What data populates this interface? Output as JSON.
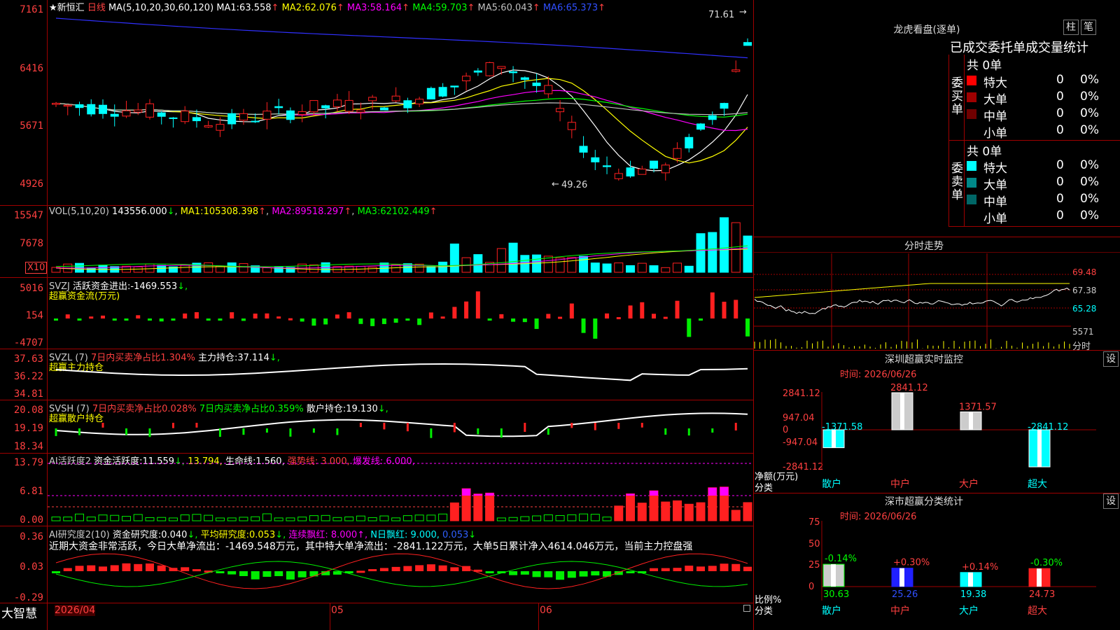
{
  "app": {
    "brand": "大智慧",
    "stock_name": "新恒汇",
    "period": "日线"
  },
  "colors": {
    "up": "#ff2020",
    "down": "#00ffff",
    "ma1": "#ffffff",
    "ma2": "#ffff00",
    "ma3": "#ff00ff",
    "ma4": "#00ff00",
    "ma5": "#c0c0c0",
    "ma6": "#3030ff",
    "grid": "#a00000",
    "label_red": "#ff4040"
  },
  "main_chart": {
    "legend_prefix": "MA(5,10,20,30,60,120)",
    "ma": [
      {
        "name": "MA1:",
        "value": "63.558",
        "arrow": "↑"
      },
      {
        "name": "MA2:",
        "value": "62.076",
        "arrow": "↑"
      },
      {
        "name": "MA3:",
        "value": "58.164",
        "arrow": "↑"
      },
      {
        "name": "MA4:",
        "value": "59.703",
        "arrow": "↑"
      },
      {
        "name": "MA5:",
        "value": "60.043",
        "arrow": "↑"
      },
      {
        "name": "MA6:",
        "value": "65.373",
        "arrow": "↑"
      }
    ],
    "y_ticks": [
      "7161",
      "6416",
      "5671",
      "4926"
    ],
    "high_label": "71.61",
    "low_label": "49.26"
  },
  "vol": {
    "header": "VOL(5,10,20)",
    "value": "143556.000",
    "arrow": "↓",
    "ma": [
      {
        "name": "MA1:",
        "value": "105308.398",
        "arrow": "↑"
      },
      {
        "name": "MA2:",
        "value": "89518.297",
        "arrow": "↑"
      },
      {
        "name": "MA3:",
        "value": "62102.449",
        "arrow": "↑"
      }
    ],
    "y_ticks": [
      "15547",
      "7678"
    ],
    "unit": "X10"
  },
  "svzj": {
    "header": "SVZJ",
    "label": "活跃资金进出:",
    "value": "-1469.553",
    "arrow": "↓,",
    "sub": "超赢资金流(万元)",
    "y_ticks": [
      "5016",
      "154",
      "-4707"
    ]
  },
  "svzl": {
    "header": "SVZL (7)",
    "ratio_label": "7日内买卖净占比1.304%",
    "pos_label": "主力持仓:",
    "pos_value": "37.114",
    "arrow": "↓,",
    "sub": "超赢主力持仓",
    "y_ticks": [
      "37.63",
      "36.22",
      "34.81"
    ]
  },
  "svsh": {
    "header": "SVSH (7)",
    "ratio1": "7日内买卖净占比0.028%",
    "ratio2": "7日内买卖净占比0.359%",
    "pos_label": "散户持仓:",
    "pos_value": "19.130",
    "arrow": "↓,",
    "sub": "超赢散户持仓",
    "y_ticks": [
      "20.08",
      "19.19",
      "18.34"
    ]
  },
  "ai_act": {
    "header": "AI活跃度2",
    "v1_label": "资金活跃度:",
    "v1": "11.559",
    "v1_arrow": "↓,",
    "v2": "13.794,",
    "v3_label": "生命线:",
    "v3": "1.560,",
    "v4": "强势线:  3.000,",
    "v5": "爆发线:  6.000,",
    "y_ticks": [
      "13.79",
      "6.81",
      "0.00"
    ]
  },
  "ai_res": {
    "header": "AI研究度2(10)",
    "r1_label": "资金研究度:",
    "r1": "0.040",
    "r1_arrow": "↓,",
    "r2_label": "平均研究度:",
    "r2": "0.053",
    "r2_arrow": "↓,",
    "r3": "连续飘红: 8.000↑,",
    "r4": "N日飘红:  9.000,",
    "r5": "0.053",
    "r5_arrow": "↓",
    "comment": "近期大资金非常活跃，今日大单净流出：-1469.548万元，其中特大单净流出：-2841.122万元，大单5日累计净入4614.046万元，当前主力控盘强",
    "y_ticks": [
      "0.36",
      "0.03",
      "-0.29"
    ]
  },
  "time_axis": {
    "t1": "2026/04",
    "t2": "05",
    "t3": "06"
  },
  "dragon_tiger": {
    "title": "龙虎看盘(逐单)",
    "btn1": "柱",
    "btn2": "笔",
    "tabs": "已成交委托单成交量统计",
    "buy": {
      "side_label": "委买单",
      "total": "共 0单",
      "rows": [
        {
          "label": "特大",
          "count": "0",
          "pct": "0%"
        },
        {
          "label": "大单",
          "count": "0",
          "pct": "0%"
        },
        {
          "label": "中单",
          "count": "0",
          "pct": "0%"
        },
        {
          "label": "小单",
          "count": "0",
          "pct": "0%"
        }
      ]
    },
    "sell": {
      "side_label": "委卖单",
      "total": "共 0单",
      "rows": [
        {
          "label": "特大",
          "count": "0",
          "pct": "0%"
        },
        {
          "label": "大单",
          "count": "0",
          "pct": "0%"
        },
        {
          "label": "中单",
          "count": "0",
          "pct": "0%"
        },
        {
          "label": "小单",
          "count": "0",
          "pct": "0%"
        }
      ]
    }
  },
  "intraday": {
    "title": "分时走势",
    "y_ticks": [
      "69.48",
      "67.38",
      "65.28"
    ],
    "vol_tick": "5571",
    "vol_label": "分时"
  },
  "sz_monitor": {
    "title": "深圳超赢实时监控",
    "btn": "设",
    "time": "时间: 2026/06/26",
    "y_ticks": [
      "2841.12",
      "947.04",
      "0",
      "-947.04",
      "-2841.12"
    ],
    "y_name": "净额(万元)",
    "x_name": "分类",
    "categories": [
      "散户",
      "中户",
      "大户",
      "超大"
    ],
    "values": [
      -1371.58,
      2841.12,
      1371.57,
      -2841.12
    ],
    "value_labels": [
      "-1371.58",
      "2841.12",
      "1371.57",
      "-2841.12"
    ]
  },
  "sz_class": {
    "title": "深市超赢分类统计",
    "btn": "设",
    "time": "时间: 2026/06/26",
    "y_ticks": [
      "75",
      "50",
      "25",
      "0"
    ],
    "y_name": "比例%",
    "x_name": "分类",
    "categories": [
      "散户",
      "中户",
      "大户",
      "超大"
    ],
    "values": [
      30.63,
      25.26,
      19.38,
      24.73
    ],
    "value_labels": [
      "30.63",
      "25.26",
      "19.38",
      "24.73"
    ],
    "changes": [
      "-0.14%",
      "+0.30%",
      "+0.14%",
      "-0.30%"
    ]
  },
  "chart_data": {
    "type": "candlestick",
    "title": "新恒汇 日线",
    "x_ticks": [
      "2026/04",
      "05",
      "06"
    ],
    "price_range": [
      49.26,
      71.61
    ],
    "last_ma": {
      "MA1": 63.558,
      "MA2": 62.076,
      "MA3": 58.164,
      "MA4": 59.703,
      "MA5": 60.043,
      "MA6": 65.373
    }
  }
}
